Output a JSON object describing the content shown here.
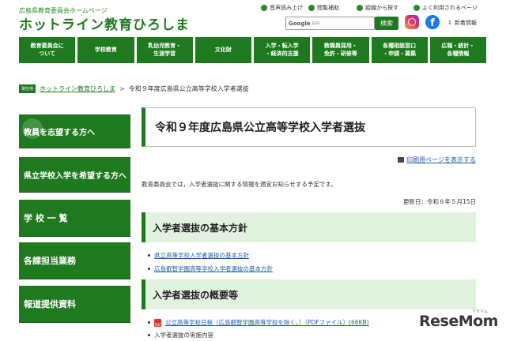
{
  "header": {
    "subtitle": "広島県教育委員会ホームページ",
    "title": "ホットライン教育ひろしま",
    "utilities": [
      {
        "label": "音声読み上げ",
        "icon": "speaker-icon"
      },
      {
        "label": "閲覧補助",
        "icon": "settings-icon"
      },
      {
        "label": "組織から探す",
        "icon": "org-icon"
      },
      {
        "label": "よく利用されるページ",
        "icon": "check-icon"
      }
    ],
    "search_logo": "Google",
    "search_logo_sub": "提供",
    "search_placeholder": "",
    "search_button": "検索",
    "facebook_letter": "f",
    "new_info": "新着情報"
  },
  "nav": [
    {
      "label": "教育委員会に\nついて"
    },
    {
      "label": "学校教育"
    },
    {
      "label": "乳幼児教育・\n生涯学習"
    },
    {
      "label": "文化財"
    },
    {
      "label": "入学・転入学\n・経済的支援"
    },
    {
      "label": "教職員採用・\n免許・研修等"
    },
    {
      "label": "各種相談窓口\n・申請・募集"
    },
    {
      "label": "広報・統計・\n各種情報"
    }
  ],
  "breadcrumb": {
    "badge": "現在地",
    "home": "ホットライン教育ひろしま",
    "separator": ">",
    "current": "令和９年度広島県公立高等学校入学者選抜"
  },
  "sidebar": [
    {
      "label": "教員を志望する方へ"
    },
    {
      "label": "県立学校入学を希望する方へ"
    },
    {
      "label": "学 校 一 覧"
    },
    {
      "label": "各課担当業務"
    },
    {
      "label": "報道提供資料"
    }
  ],
  "main": {
    "page_title": "令和９年度広島県公立高等学校入学者選抜",
    "print_link": "印刷用ページを表示する",
    "intro": "教育委員会では，入学者選抜に関する情報を適宜お知らせする予定です。",
    "updated": "更新日：令和８年５月15日",
    "sections": [
      {
        "heading": "入学者選抜の基本方針",
        "links": [
          "県立高等学校入学者選抜の基本方針",
          "広島叡智学園高等学校入学者選抜の基本方針"
        ]
      },
      {
        "heading": "入学者選抜の概要等",
        "links": [
          "公立高等学校日程（広島叡智学園高等学校を除く。）（PDFファイル）(66KB)"
        ],
        "plain_items": [
          "入学者選抜の実施内容"
        ]
      }
    ]
  },
  "watermark": {
    "text": "ReseMom",
    "sub": "リセマム"
  },
  "colors": {
    "primary_green": "#1f7a1f",
    "section_bg": "#e1f2de",
    "link_blue": "#1f5fa8"
  }
}
